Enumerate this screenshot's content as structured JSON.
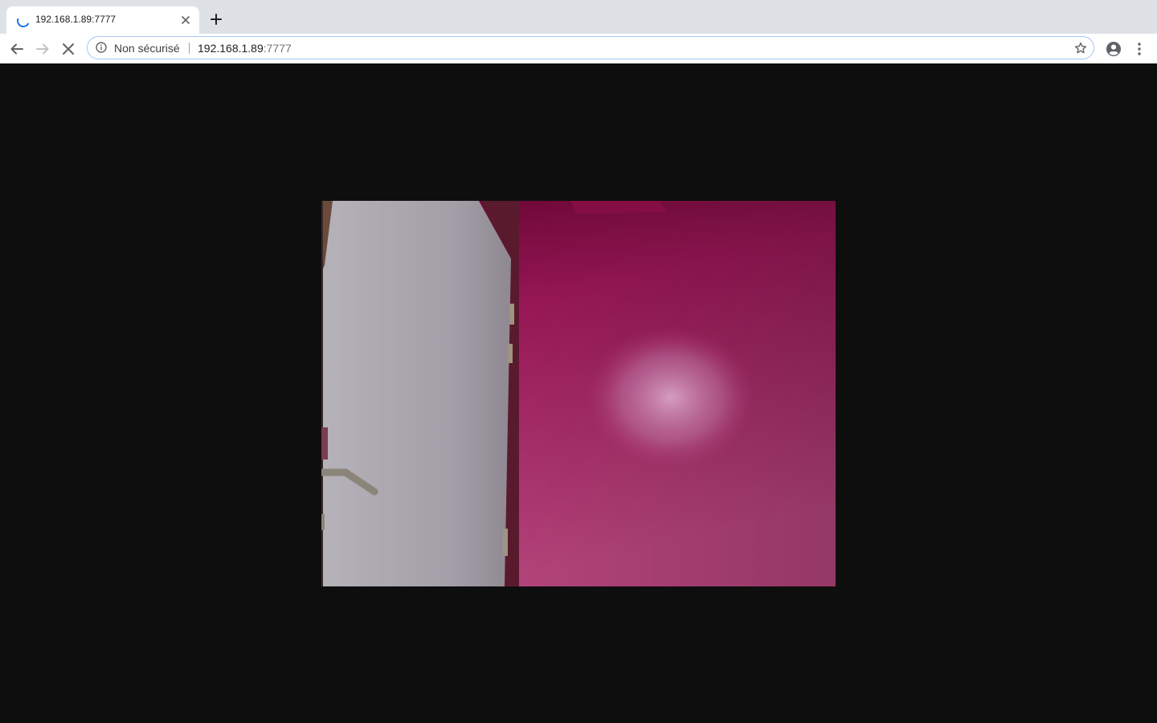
{
  "tab": {
    "title": "192.168.1.89:7777",
    "loading_icon": "loading-spinner-icon",
    "close_icon": "close-icon"
  },
  "new_tab": {
    "icon": "plus-icon"
  },
  "toolbar": {
    "back_icon": "arrow-left-icon",
    "forward_icon": "arrow-right-icon",
    "stop_icon": "close-icon",
    "bookmark_icon": "star-icon",
    "profile_icon": "account-circle-icon",
    "menu_icon": "kebab-menu-icon"
  },
  "omnibox": {
    "security_label": "Non sécurisé",
    "url_host": "192.168.1.89",
    "url_port": ":7777",
    "info_icon": "info-icon"
  },
  "content": {
    "video_stream": "camera-stream-image"
  },
  "colors": {
    "tabstrip_bg": "#dee1e6",
    "page_bg": "#0e0e0e",
    "omnibox_focus": "#a8c7fa",
    "spinner": "#1a73e8",
    "wall_magenta": "#b8266d",
    "door_gray": "#a9a4ad"
  }
}
